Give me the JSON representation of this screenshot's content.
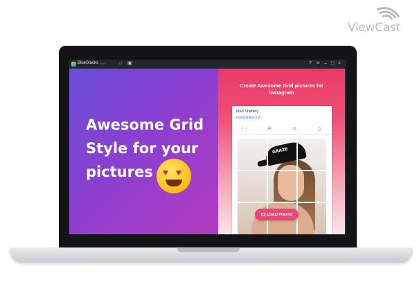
{
  "watermark": {
    "text": "ViewCast"
  },
  "emulator": {
    "app_name": "BlueStacks",
    "version": "Android 7.1 · BlueStacks 4",
    "toolbar_icons": [
      "home-icon",
      "apps-icon",
      "help-icon",
      "menu-icon",
      "minimize-icon",
      "maximize-icon",
      "close-icon",
      "expand-icon"
    ],
    "sidebar_icons": [
      "fullscreen-icon",
      "volume-up-icon",
      "volume-down-icon",
      "keyboard-icon",
      "camera-icon",
      "rotate-icon",
      "shake-icon",
      "screenshot-icon",
      "record-icon",
      "folder-icon",
      "copy-icon",
      "location-icon",
      "more-icon",
      "settings-icon",
      "back-icon",
      "home-icon",
      "recent-icon"
    ]
  },
  "promo": {
    "headline_line1": "Awesome Grid",
    "headline_line2": "Style for your",
    "headline_line3": "pictures",
    "emoji": "heart-eyes-emoji",
    "right_title": "Create Awesome Grid pictures for instagram"
  },
  "app_preview": {
    "user_name": "Mari Shebley",
    "user_site": "marishibley.com",
    "tabs": [
      "grid-icon",
      "list-icon",
      "location-icon",
      "person-icon"
    ],
    "cap_text": "GRAZE",
    "load_button": "LOAD PHOTO"
  },
  "colors": {
    "left_bg_start": "#6a4fd8",
    "left_bg_end": "#b43cc0",
    "accent": "#e84777"
  }
}
